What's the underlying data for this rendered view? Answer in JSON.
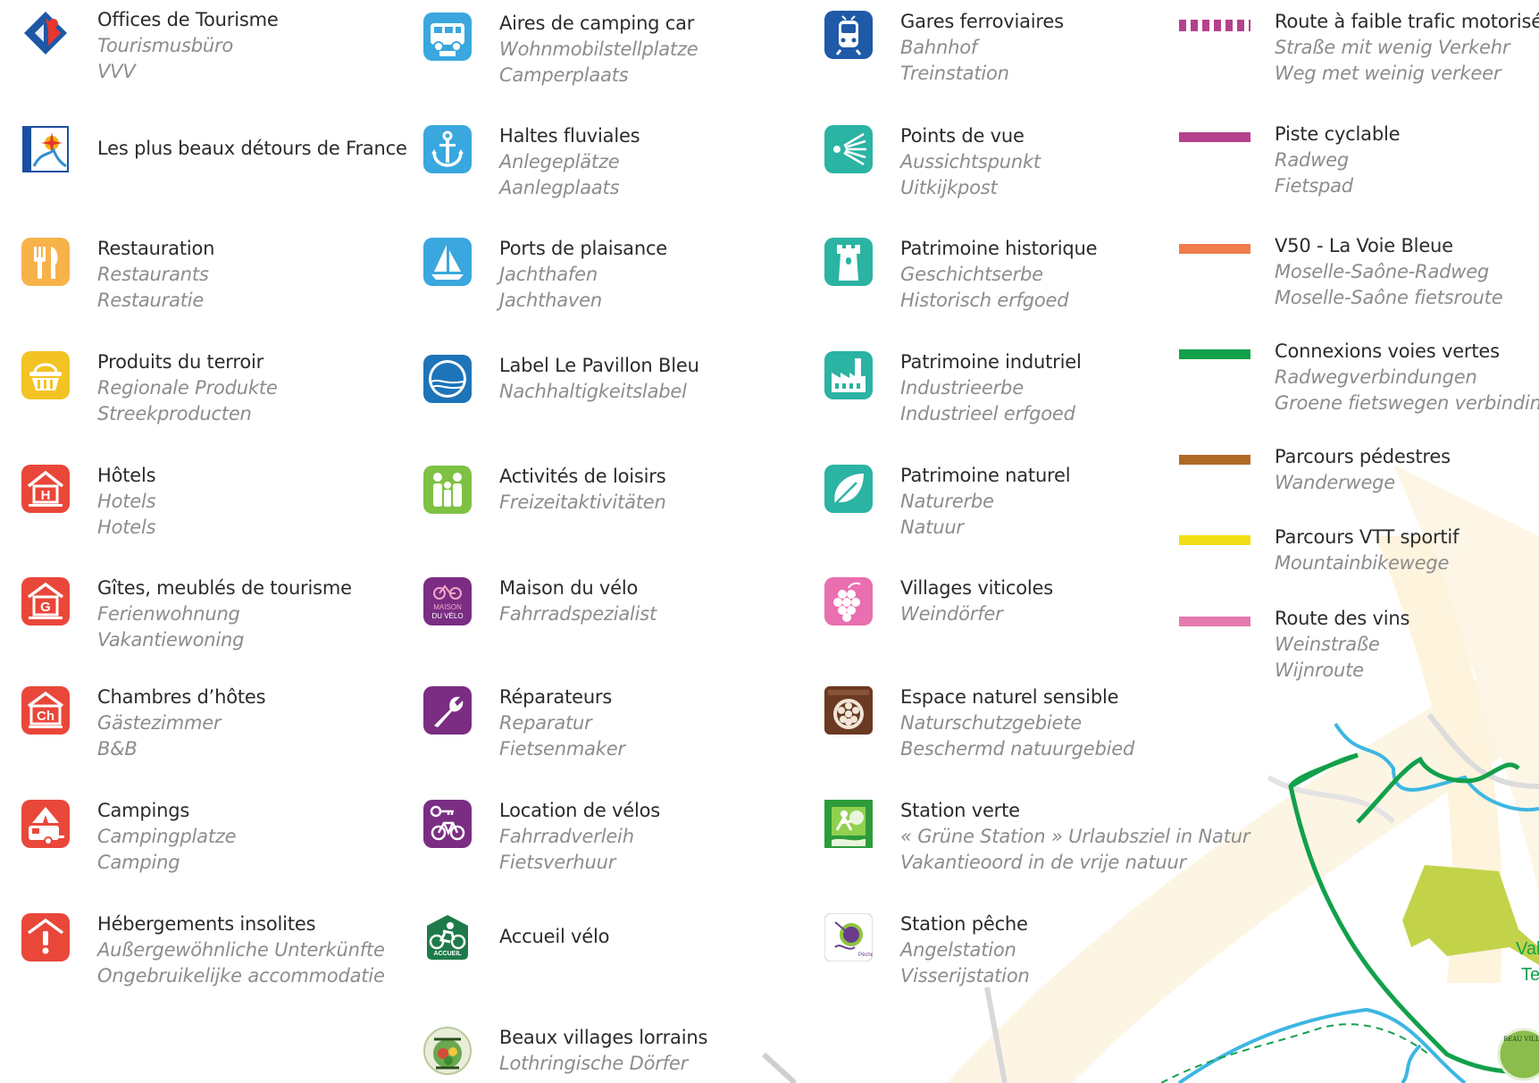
{
  "col1": [
    {
      "icon": "tourism-office-icon",
      "color": "#1d58a5",
      "l1": "Offices de Tourisme",
      "l2": "Tourismusbüro",
      "l3": "VVV"
    },
    {
      "icon": "beaux-detours-icon",
      "color": "#1d4fa0",
      "l1": "Les plus beaux détours de France",
      "l2": "",
      "l3": ""
    },
    {
      "icon": "fork-knife-icon",
      "color": "#f7b24a",
      "l1": "Restauration",
      "l2": "Restaurants",
      "l3": "Restauratie"
    },
    {
      "icon": "basket-icon",
      "color": "#f3c324",
      "l1": "Produits du terroir",
      "l2": "Regionale Produkte",
      "l3": "Streekproducten"
    },
    {
      "icon": "hotel-icon",
      "color": "#e9473a",
      "l1": "Hôtels",
      "l2": "Hotels",
      "l3": "Hotels"
    },
    {
      "icon": "gite-icon",
      "color": "#e9473a",
      "l1": "Gîtes, meublés de tourisme",
      "l2": "Ferienwohnung",
      "l3": "Vakantiewoning"
    },
    {
      "icon": "chambre-hotes-icon",
      "color": "#e9473a",
      "l1": "Chambres d’hôtes",
      "l2": "Gästezimmer",
      "l3": "B&B"
    },
    {
      "icon": "camping-icon",
      "color": "#e9473a",
      "l1": "Campings",
      "l2": "Campingplatze",
      "l3": "Camping"
    },
    {
      "icon": "unusual-lodging-icon",
      "color": "#e9473a",
      "l1": "Hébergements insolites",
      "l2": "Außergewöhnliche Unterkünfte",
      "l3": "Ongebruikelijke accommodatie"
    }
  ],
  "col2": [
    {
      "icon": "camper-van-icon",
      "color": "#3aa7de",
      "l1": "Aires de camping car",
      "l2": "Wohnmobilstellplatze",
      "l3": "Camperplaats"
    },
    {
      "icon": "anchor-icon",
      "color": "#3aa7de",
      "l1": "Haltes fluviales",
      "l2": "Anlegeplätze",
      "l3": "Aanlegplaats"
    },
    {
      "icon": "sailboat-icon",
      "color": "#3aa7de",
      "l1": "Ports de plaisance",
      "l2": "Jachthafen",
      "l3": "Jachthaven"
    },
    {
      "icon": "blue-flag-icon",
      "color": "#1e74b8",
      "l1": "Label Le Pavillon Bleu",
      "l2": "Nachhaltigkeitslabel",
      "l3": ""
    },
    {
      "icon": "leisure-family-icon",
      "color": "#7dc242",
      "l1": "Activités de loisirs",
      "l2": "Freizeitaktivitäten",
      "l3": ""
    },
    {
      "icon": "maison-velo-icon",
      "color": "#7a2d83",
      "l1": "Maison du vélo",
      "l2": "Fahrradspezialist",
      "l3": ""
    },
    {
      "icon": "wrench-icon",
      "color": "#7a2d83",
      "l1": "Réparateurs",
      "l2": "Reparatur",
      "l3": "Fietsenmaker"
    },
    {
      "icon": "bike-rental-icon",
      "color": "#7a2d83",
      "l1": "Location de vélos",
      "l2": "Fahrradverleih",
      "l3": "Fietsverhuur"
    },
    {
      "icon": "accueil-velo-icon",
      "color": "#1e7a4a",
      "l1": "Accueil vélo",
      "l2": "",
      "l3": ""
    },
    {
      "icon": "beaux-villages-icon",
      "color": "#6aa84f",
      "l1": "Beaux villages lorrains",
      "l2": "Lothringische Dörfer",
      "l3": ""
    }
  ],
  "col3": [
    {
      "icon": "train-icon",
      "color": "#1e5aa8",
      "l1": "Gares ferroviaires",
      "l2": "Bahnhof",
      "l3": "Treinstation"
    },
    {
      "icon": "viewpoint-icon",
      "color": "#2bb3a3",
      "l1": "Points de vue",
      "l2": "Aussichtspunkt",
      "l3": "Uitkijkpost"
    },
    {
      "icon": "castle-tower-icon",
      "color": "#2bb3a3",
      "l1": "Patrimoine historique",
      "l2": "Geschichtserbe",
      "l3": "Historisch erfgoed"
    },
    {
      "icon": "factory-icon",
      "color": "#2bb3a3",
      "l1": "Patrimoine indutriel",
      "l2": "Industrieerbe",
      "l3": "Industrieel erfgoed"
    },
    {
      "icon": "leaf-icon",
      "color": "#2bb3a3",
      "l1": "Patrimoine naturel",
      "l2": "Naturerbe",
      "l3": "Natuur"
    },
    {
      "icon": "grapes-icon",
      "color": "#e96fb0",
      "l1": "Villages viticoles",
      "l2": "Weindörfer",
      "l3": ""
    },
    {
      "icon": "ens-icon",
      "color": "#6b3a22",
      "l1": "Espace naturel sensible",
      "l2": "Naturschutzgebiete",
      "l3": "Beschermd natuurgebied"
    },
    {
      "icon": "station-verte-icon",
      "color": "#2e9b3a",
      "l1": "Station verte",
      "l2": "« Grüne Station » Urlaubsziel in Natur",
      "l3": "Vakantieoord in de vrije natuur"
    },
    {
      "icon": "station-peche-icon",
      "color": "#8fc33f",
      "l1": "Station pêche",
      "l2": "Angelstation",
      "l3": "Visserijstation"
    }
  ],
  "col4": [
    {
      "line": "dashed",
      "color": "#b5418d",
      "l1": "Route à faible trafic motorisé",
      "l2": "Straße mit wenig Verkehr",
      "l3": "Weg met weinig verkeer"
    },
    {
      "line": "solid",
      "color": "#b5418d",
      "l1": "Piste cyclable",
      "l2": "Radweg",
      "l3": "Fietspad"
    },
    {
      "line": "solid",
      "color": "#ef7d4e",
      "l1": "V50 - La Voie Bleue",
      "l2": "Moselle-Saône-Radweg",
      "l3": "Moselle-Saône fietsroute"
    },
    {
      "line": "solid",
      "color": "#12a04b",
      "l1": "Connexions voies vertes",
      "l2": "Radwegverbindungen",
      "l3": "Groene fietswegen verbindingen"
    },
    {
      "line": "solid",
      "color": "#b06a27",
      "l1": "Parcours pédestres",
      "l2": "Wanderwege",
      "l3": ""
    },
    {
      "line": "solid",
      "color": "#f2de14",
      "l1": "Parcours VTT sportif",
      "l2": "Mountainbikewege",
      "l3": ""
    },
    {
      "line": "solid",
      "color": "#e57aae",
      "l1": "Route des vins",
      "l2": "Weinstraße",
      "l3": "Wijnroute"
    }
  ],
  "map": {
    "label1": "Val",
    "label2": "Te",
    "badge_text": "BEAU VILLA"
  }
}
